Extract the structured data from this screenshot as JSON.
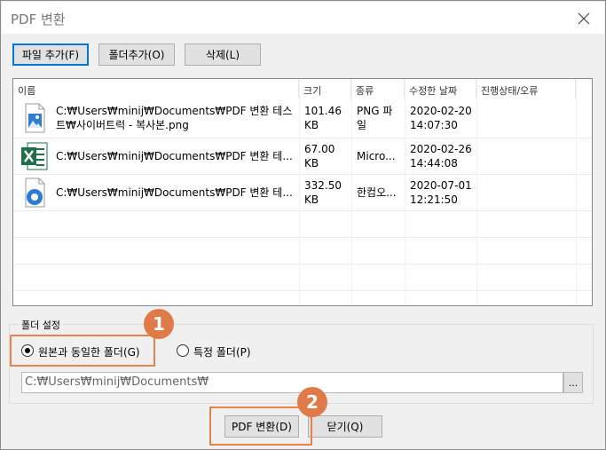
{
  "window": {
    "title": "PDF 변환"
  },
  "toolbar": {
    "add_file": "파일 추가(F)",
    "add_folder": "폴더추가(O)",
    "delete": "삭제(L)"
  },
  "list": {
    "columns": [
      "이름",
      "크기",
      "종류",
      "수정한 날짜",
      "진행상태/오류"
    ],
    "rows": [
      {
        "icon": "image-file-icon",
        "name_line1": "C:₩Users₩minij₩Documents₩PDF 변환 테스",
        "name_line2": "트₩사이버트럭 - 복사본.png",
        "size_line1": "101.46",
        "size_line2": "KB",
        "type_line1": "PNG 파",
        "type_line2": "일",
        "date_line1": "2020-02-20",
        "date_line2": "14:07:30",
        "status": ""
      },
      {
        "icon": "excel-file-icon",
        "name_line1": "C:₩Users₩minij₩Documents₩PDF 변환 테...",
        "name_line2": "",
        "size_line1": "67.00",
        "size_line2": "KB",
        "type_line1": "Micro...",
        "type_line2": "",
        "date_line1": "2020-02-26",
        "date_line2": "14:44:08",
        "status": ""
      },
      {
        "icon": "hwp-file-icon",
        "name_line1": "C:₩Users₩minij₩Documents₩PDF 변환 테...",
        "name_line2": "",
        "size_line1": "332.50",
        "size_line2": "KB",
        "type_line1": "한컴오...",
        "type_line2": "",
        "date_line1": "2020-07-01",
        "date_line2": "12:21:50",
        "status": ""
      }
    ]
  },
  "folder_settings": {
    "label": "폴더 설정",
    "option_same": "원본과 동일한 폴더(G)",
    "option_specific": "특정 폴더(P)",
    "selected": "same",
    "path_value": "C:₩Users₩minij₩Documents₩",
    "browse_label": "..."
  },
  "footer": {
    "convert": "PDF 변환(D)",
    "close": "닫기(Q)"
  },
  "annotations": {
    "badge1": "1",
    "badge2": "2"
  },
  "colors": {
    "highlight": "#e8834f",
    "badge": "#e07a49",
    "focus": "#0078d7"
  }
}
